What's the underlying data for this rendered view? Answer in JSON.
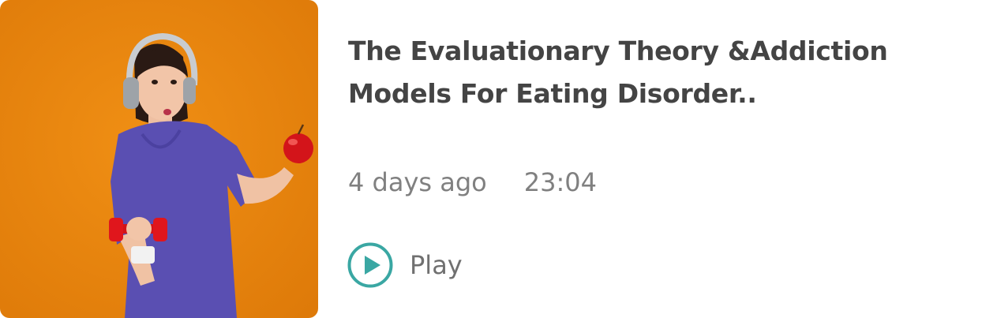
{
  "card": {
    "title_line1": "The Evaluationary Theory &Addiction",
    "title_line2": "Models For Eating Disorder..",
    "age": "4 days ago",
    "duration": "23:04",
    "play_label": "Play",
    "accent_color": "#3aa7a3",
    "thumbnail_bg_color": "#e8870e",
    "thumbnail_icon": "woman-with-headphones-apple-dumbbell-photo"
  }
}
